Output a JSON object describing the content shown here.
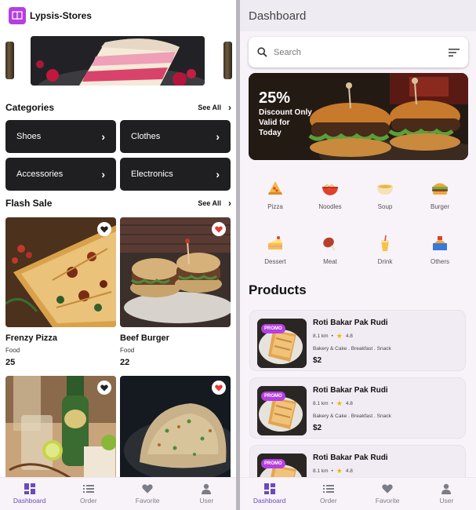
{
  "left": {
    "app_title": "Lypsis-Stores",
    "categories_title": "Categories",
    "see_all": "See All",
    "categories": [
      "Shoes",
      "Clothes",
      "Accessories",
      "Electronics"
    ],
    "flash_title": "Flash Sale",
    "products": [
      {
        "name": "Frenzy Pizza",
        "category": "Food",
        "price": "25",
        "favorite": false
      },
      {
        "name": "Beef Burger",
        "category": "Food",
        "price": "22",
        "favorite": true
      },
      {
        "name": "",
        "category": "",
        "price": "",
        "favorite": false
      },
      {
        "name": "",
        "category": "",
        "price": "",
        "favorite": true
      }
    ]
  },
  "nav": [
    {
      "label": "Dashboard",
      "icon": "dashboard-icon",
      "active": true
    },
    {
      "label": "Order",
      "icon": "list-icon",
      "active": false
    },
    {
      "label": "Favorite",
      "icon": "heart-icon",
      "active": false
    },
    {
      "label": "User",
      "icon": "person-icon",
      "active": false
    }
  ],
  "right": {
    "title": "Dashboard",
    "search_placeholder": "Search",
    "banner": {
      "percent": "25%",
      "line1": "Discount Only",
      "line2": "Valid for",
      "line3": "Today"
    },
    "food_categories": [
      "Pizza",
      "Noodles",
      "Soup",
      "Burger",
      "Dessert",
      "Meat",
      "Drink",
      "Others"
    ],
    "products_title": "Products",
    "product_list": [
      {
        "badge": "PROMO",
        "name": "Roti Bakar Pak Rudi",
        "distance": "8.1 km",
        "rating": "4.8",
        "tags": "Bakery & Cake . Breakfast . Snack",
        "price": "$2"
      },
      {
        "badge": "PROMO",
        "name": "Roti Bakar Pak Rudi",
        "distance": "8.1 km",
        "rating": "4.8",
        "tags": "Bakery & Cake . Breakfast . Snack",
        "price": "$2"
      },
      {
        "badge": "PROMO",
        "name": "Roti Bakar Pak Rudi",
        "distance": "8.1 km",
        "rating": "4.8",
        "tags": "",
        "price": ""
      }
    ]
  },
  "colors": {
    "accent": "#6a4bb8",
    "promo": "#b53fe0",
    "dark_button": "#1f1f22",
    "heart_red": "#e53935",
    "star": "#f5b301"
  }
}
